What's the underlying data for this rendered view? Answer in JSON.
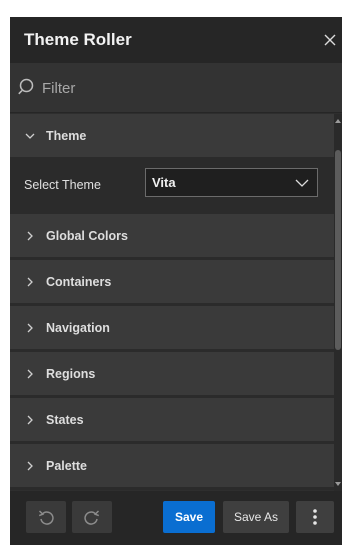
{
  "panel": {
    "title": "Theme Roller",
    "close_icon": "close-icon"
  },
  "filter": {
    "placeholder": "Filter",
    "value": "",
    "icon": "search-icon"
  },
  "sections": [
    {
      "id": "theme",
      "label": "Theme",
      "expanded": true
    },
    {
      "id": "global-colors",
      "label": "Global Colors",
      "expanded": false
    },
    {
      "id": "containers",
      "label": "Containers",
      "expanded": false
    },
    {
      "id": "navigation",
      "label": "Navigation",
      "expanded": false
    },
    {
      "id": "regions",
      "label": "Regions",
      "expanded": false
    },
    {
      "id": "states",
      "label": "States",
      "expanded": false
    },
    {
      "id": "palette",
      "label": "Palette",
      "expanded": false
    }
  ],
  "theme_section": {
    "select_label": "Select Theme",
    "selected_value": "Vita"
  },
  "footer": {
    "undo_icon": "undo-icon",
    "redo_icon": "redo-icon",
    "save_label": "Save",
    "save_as_label": "Save As",
    "more_icon": "more-vertical-icon"
  },
  "colors": {
    "panel_bg": "#2e2e2e",
    "header_bg": "#262626",
    "section_bg": "#3a3a3a",
    "primary": "#0a6ed1",
    "text": "#e6e6e6"
  }
}
